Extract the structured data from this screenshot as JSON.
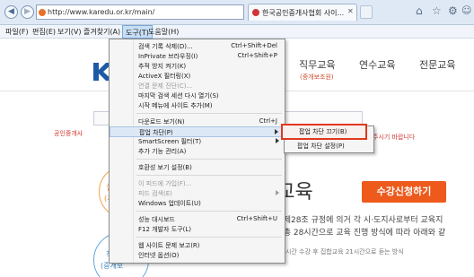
{
  "browser": {
    "address": "http://www.karedu.or.kr/main/",
    "tab_title": "한국공인중개사협회 사이...",
    "back_glyph": "◀",
    "forward_glyph": "▶",
    "search_glyph": "⌕",
    "lock_glyph": "▾",
    "refresh_glyph": "↻",
    "close_glyph": "✕",
    "home_glyph": "⌂",
    "favorites_glyph": "☆",
    "gear_glyph": "⚙",
    "smile_glyph": "☺"
  },
  "menubar": {
    "file": "파일(F)",
    "edit": "편집(E)",
    "view": "보기(V)",
    "favorites": "즐겨찾기(A)",
    "tools": "도구(T)",
    "help": "도움말(H)"
  },
  "page": {
    "nav": {
      "direct": "직무교육",
      "direct_sub": "(중개보조원)",
      "training": "연수교육",
      "expert": "전문교육"
    },
    "notice_left": "공인중개사",
    "notice_right": "주시기 바랍니다",
    "circle1_text": "실무",
    "circle1_sub": "(개설",
    "circle2_text": "직무",
    "circle2_sub": "(중개보",
    "heading": "무교육",
    "apply_button": "수강신청하기",
    "desc_line_1": "시행령 제28조 규정에 의거 각 시·도지사로부터 교육지",
    "desc_line_2": "교육은 총 28시간으로 교육 진행 방식에 따라 아래와 같",
    "bottom_note": "사이버 집합교육 인터넷 동영상으로 7시간 수강 후 집합교육 21시간으로 듣는 방식"
  },
  "tools_menu": {
    "items": [
      {
        "label": "검색 기록 삭제(D)...",
        "shortcut": "Ctrl+Shift+Del"
      },
      {
        "label": "InPrivate 브라우징(I)",
        "shortcut": "Ctrl+Shift+P"
      },
      {
        "label": "추적 방지 켜기(K)",
        "shortcut": ""
      },
      {
        "label": "ActiveX 필터링(X)",
        "shortcut": ""
      },
      {
        "label": "연결 문제 진단(C)...",
        "shortcut": ""
      },
      {
        "label": "마지막 검색 세션 다시 열기(S)",
        "shortcut": ""
      },
      {
        "label": "시작 메뉴에 사이트 추가(M)",
        "shortcut": ""
      },
      {
        "label": "다운로드 보기(N)",
        "shortcut": "Ctrl+J"
      },
      {
        "label": "팝업 차단(P)",
        "shortcut": ""
      },
      {
        "label": "SmartScreen 필터(T)",
        "shortcut": ""
      },
      {
        "label": "추가 기능 관리(A)",
        "shortcut": ""
      },
      {
        "label": "호환성 보기 설정(B)",
        "shortcut": ""
      },
      {
        "label": "이 피드에 가입(F)...",
        "shortcut": ""
      },
      {
        "label": "피드 검색(E)",
        "shortcut": ""
      },
      {
        "label": "Windows 업데이트(U)",
        "shortcut": ""
      },
      {
        "label": "성능 대시보드",
        "shortcut": "Ctrl+Shift+U"
      },
      {
        "label": "F12 개발자 도구(L)",
        "shortcut": ""
      },
      {
        "label": "웹 사이트 문제 보고(R)",
        "shortcut": ""
      },
      {
        "label": "인터넷 옵션(O)",
        "shortcut": ""
      }
    ]
  },
  "popup_submenu": {
    "off_label": "팝업 차단 끄기(B)",
    "settings_label": "팝업 차단 설정(P)"
  },
  "colors": {
    "accent_orange": "#ee5a1c",
    "highlight_red_box": "#e2371f",
    "brand_red": "#d2352f",
    "brand_blue": "#1d5aa6"
  }
}
